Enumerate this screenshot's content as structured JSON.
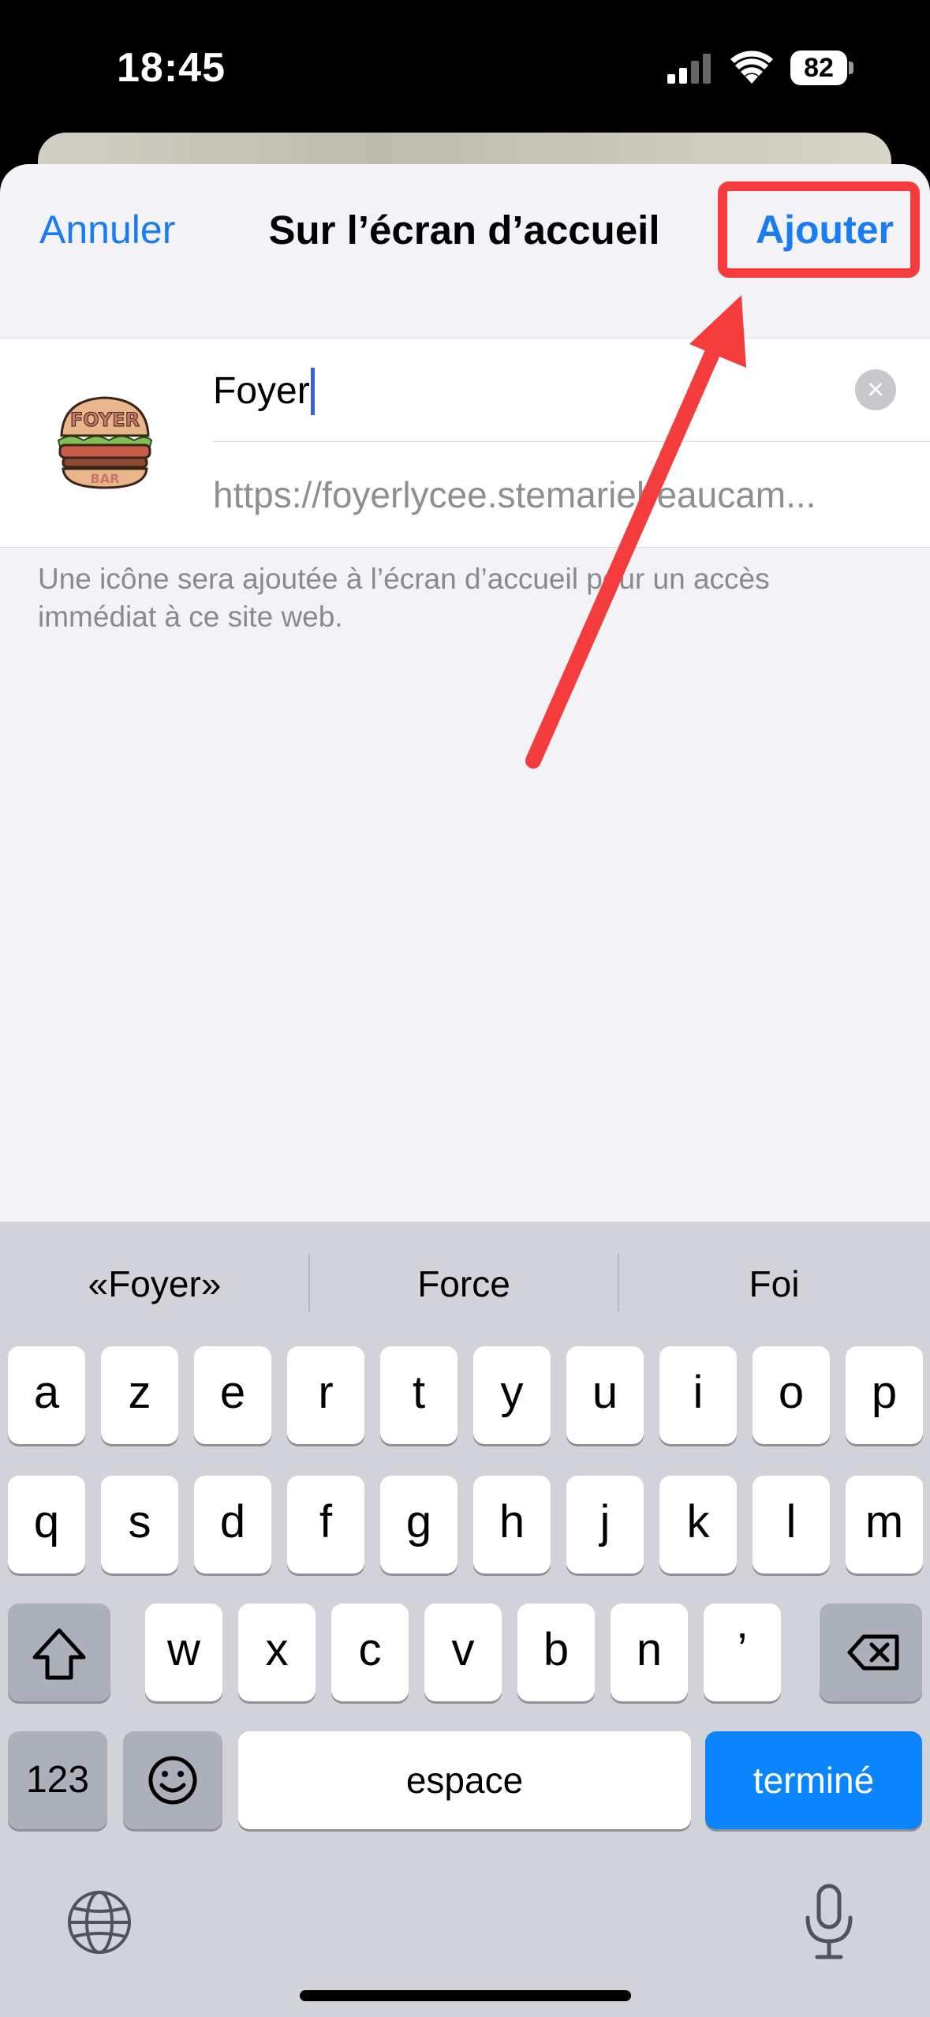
{
  "status_bar": {
    "time": "18:45",
    "battery": "82"
  },
  "header": {
    "cancel_label": "Annuler",
    "title": "Sur l’écran d’accueil",
    "add_label": "Ajouter"
  },
  "form": {
    "name_value": "Foyer",
    "url_value": "https://foyerlycee.stemariebeaucam...",
    "help_text": "Une icône sera ajoutée à l’écran d’accueil pour un accès immédiat à ce site web."
  },
  "suggestions": [
    "«Foyer»",
    "Force",
    "Foi"
  ],
  "keyboard": {
    "row1": [
      "a",
      "z",
      "e",
      "r",
      "t",
      "y",
      "u",
      "i",
      "o",
      "p"
    ],
    "row2": [
      "q",
      "s",
      "d",
      "f",
      "g",
      "h",
      "j",
      "k",
      "l",
      "m"
    ],
    "row3": [
      "w",
      "x",
      "c",
      "v",
      "b",
      "n",
      "’"
    ],
    "numbers_label": "123",
    "space_label": "espace",
    "done_label": "terminé"
  },
  "icons": [
    "signal-icon",
    "wifi-icon",
    "battery-icon",
    "app-icon",
    "clear-icon",
    "shift-icon",
    "delete-icon",
    "emoji-icon",
    "globe-icon",
    "microphone-icon",
    "annotation-arrow"
  ],
  "colors": {
    "accent": "#1a7cf5",
    "annotation": "#f53c3c",
    "done_key": "#0a84ff"
  }
}
